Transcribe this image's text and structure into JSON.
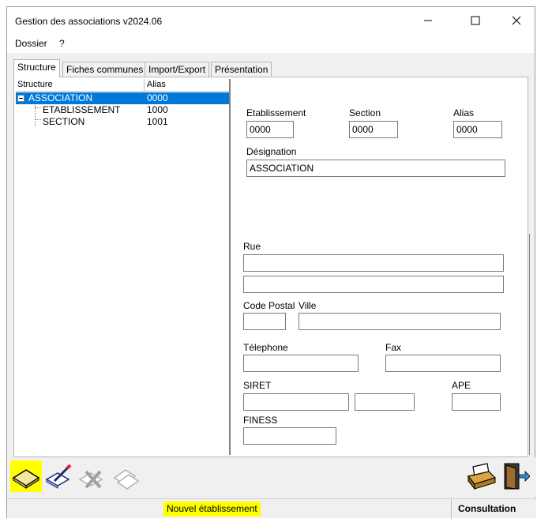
{
  "window": {
    "title": "Gestion des associations v2024.06"
  },
  "menu": {
    "items": [
      "Dossier",
      "?"
    ]
  },
  "tabs": [
    "Structure",
    "Fiches communes",
    "Import/Export",
    "Présentation"
  ],
  "tree": {
    "headers": {
      "structure": "Structure",
      "alias": "Alias"
    },
    "rows": [
      {
        "label": "ASSOCIATION",
        "alias": "0000",
        "selected": true
      },
      {
        "label": "ETABLISSEMENT",
        "alias": "1000",
        "selected": false
      },
      {
        "label": "SECTION",
        "alias": "1001",
        "selected": false
      }
    ]
  },
  "form": {
    "etablissement": {
      "label": "Etablissement",
      "value": "0000"
    },
    "section": {
      "label": "Section",
      "value": "0000"
    },
    "alias": {
      "label": "Alias",
      "value": "0000"
    },
    "designation": {
      "label": "Désignation",
      "value": "ASSOCIATION"
    },
    "rue": {
      "label": "Rue",
      "line1": "",
      "line2": ""
    },
    "code_postal": {
      "label": "Code Postal",
      "value": ""
    },
    "ville": {
      "label": "Ville",
      "value": ""
    },
    "telephone": {
      "label": "Télephone",
      "value": ""
    },
    "fax": {
      "label": "Fax",
      "value": ""
    },
    "siret": {
      "label": "SIRET",
      "value1": "",
      "value2": ""
    },
    "ape": {
      "label": "APE",
      "value": ""
    },
    "finess": {
      "label": "FINESS",
      "value": ""
    }
  },
  "toolbar": {
    "buttons": [
      "new-establishment-icon",
      "edit-icon",
      "delete-icon",
      "copy-icon"
    ],
    "right": [
      "printer-icon",
      "exit-door-icon"
    ]
  },
  "status": {
    "message": "Nouvel établissement",
    "mode": "Consultation"
  },
  "colors": {
    "selection": "#0078d7",
    "highlight": "#ffff00"
  }
}
